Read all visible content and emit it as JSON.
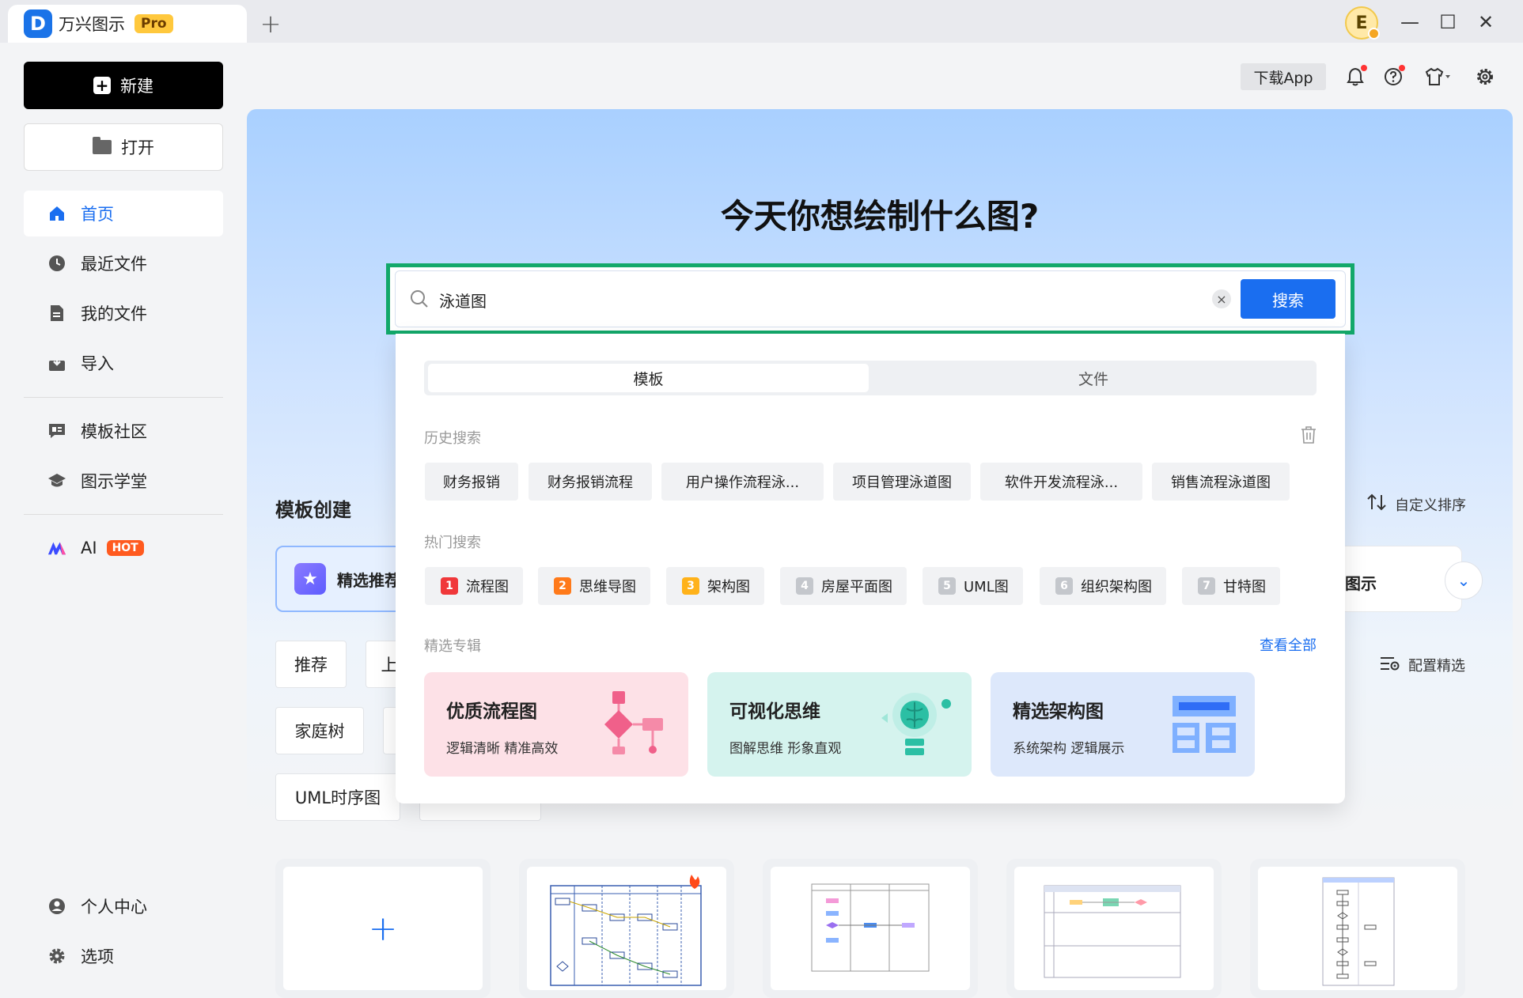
{
  "app": {
    "logo_letter": "D",
    "name": "万兴图示",
    "badge": "Pro",
    "new_tab": "+"
  },
  "user": {
    "avatar_letter": "E"
  },
  "window": {
    "minimize": "—",
    "maximize": "☐",
    "close": "✕"
  },
  "sidebar": {
    "new_label": "新建",
    "open_label": "打开",
    "items": [
      {
        "label": "首页"
      },
      {
        "label": "最近文件"
      },
      {
        "label": "我的文件"
      },
      {
        "label": "导入"
      },
      {
        "label": "模板社区"
      },
      {
        "label": "图示学堂"
      },
      {
        "label": "AI",
        "badge": "HOT"
      },
      {
        "label": "个人中心"
      },
      {
        "label": "选项"
      }
    ]
  },
  "topbar": {
    "download_label": "下载App"
  },
  "hero": {
    "headline": "今天你想绘制什么图?"
  },
  "search": {
    "value": "泳道图",
    "clear": "×",
    "button_label": "搜索"
  },
  "dropdown": {
    "tabs": [
      "模板",
      "文件"
    ],
    "history_label": "历史搜索",
    "history": [
      "财务报销",
      "财务报销流程",
      "用户操作流程泳...",
      "项目管理泳道图",
      "软件开发流程泳...",
      "销售流程泳道图"
    ],
    "hot_label": "热门搜索",
    "hot": [
      {
        "rank": "1",
        "label": "流程图",
        "color": "#f0383a"
      },
      {
        "rank": "2",
        "label": "思维导图",
        "color": "#ff7a1a"
      },
      {
        "rank": "3",
        "label": "架构图",
        "color": "#ffb21a"
      },
      {
        "rank": "4",
        "label": "房屋平面图",
        "color": "#c4c7cc"
      },
      {
        "rank": "5",
        "label": "UML图",
        "color": "#c4c7cc"
      },
      {
        "rank": "6",
        "label": "组织架构图",
        "color": "#c4c7cc"
      },
      {
        "rank": "7",
        "label": "甘特图",
        "color": "#c4c7cc"
      }
    ],
    "special_label": "精选专辑",
    "view_all": "查看全部",
    "specials": [
      {
        "title": "优质流程图",
        "subtitle": "逻辑清晰 精准高效",
        "bg": "#fde1e7"
      },
      {
        "title": "可视化思维",
        "subtitle": "图解思维 形象直观",
        "bg": "#d5f3ee"
      },
      {
        "title": "精选架构图",
        "subtitle": "系统架构 逻辑展示",
        "bg": "#dde8fb"
      }
    ]
  },
  "templates": {
    "section_title": "模板创建",
    "sort_label": "自定义排序",
    "featured_first": "精选推荐",
    "featured_right": "图示",
    "config_label": "配置精选",
    "chips": [
      "推荐",
      "上",
      "家庭树",
      "UML时序图"
    ],
    "blank_plus": "+"
  }
}
